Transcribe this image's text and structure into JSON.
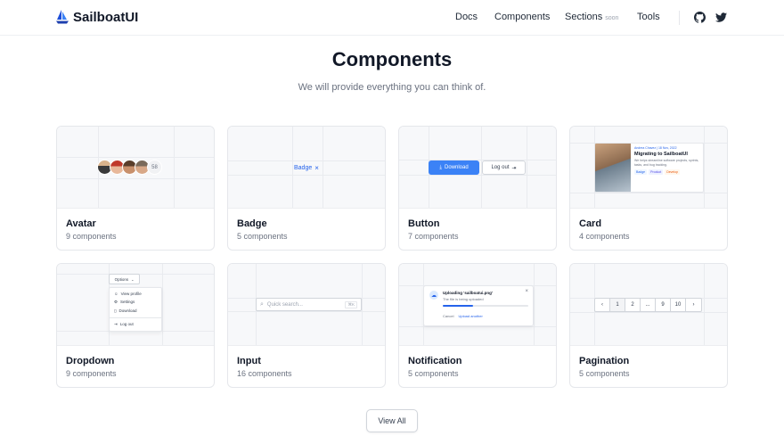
{
  "brand": {
    "name": "SailboatUI",
    "accent": "#2563eb"
  },
  "nav": {
    "links": [
      "Docs",
      "Components",
      "Sections",
      "Tools"
    ],
    "soon_badge": "soon",
    "social_icons": [
      "github-icon",
      "twitter-icon"
    ]
  },
  "hero": {
    "title": "Components",
    "subtitle": "We will provide everything you can think of."
  },
  "cards": [
    {
      "name": "Avatar",
      "count": "9 components",
      "preview": {
        "extra_count": "58"
      }
    },
    {
      "name": "Badge",
      "count": "5 components",
      "preview": {
        "badge_label": "Badge",
        "close_glyph": "×"
      }
    },
    {
      "name": "Button",
      "count": "7 components",
      "preview": {
        "primary_label": "Download",
        "secondary_label": "Log out"
      }
    },
    {
      "name": "Card",
      "count": "4 components",
      "preview": {
        "meta": "Andrea Chavez | 18 Nov, 2022",
        "title": "Migrating to SailboatUI",
        "body": "We helps streamline software projects, sprints, tasks, and bug tracking.",
        "tags": [
          "Badge",
          "Product",
          "Develop"
        ]
      }
    },
    {
      "name": "Dropdown",
      "count": "9 components",
      "preview": {
        "trigger": "Options",
        "items": [
          "View profile",
          "Settings",
          "Download",
          "Log out"
        ]
      }
    },
    {
      "name": "Input",
      "count": "16 components",
      "preview": {
        "placeholder": "Quick search...",
        "shortcut": "⌘K"
      }
    },
    {
      "name": "Notification",
      "count": "5 components",
      "preview": {
        "title": "Uploading 'sailboatui.png'",
        "subtitle": "The file is being uploaded",
        "progress": 0.35,
        "actions": [
          "Cancel",
          "Upload another"
        ]
      }
    },
    {
      "name": "Pagination",
      "count": "5 components",
      "preview": {
        "pages": [
          "1",
          "2",
          "...",
          "9",
          "10"
        ],
        "prev": "‹",
        "next": "›"
      }
    }
  ],
  "view_all": "View All"
}
